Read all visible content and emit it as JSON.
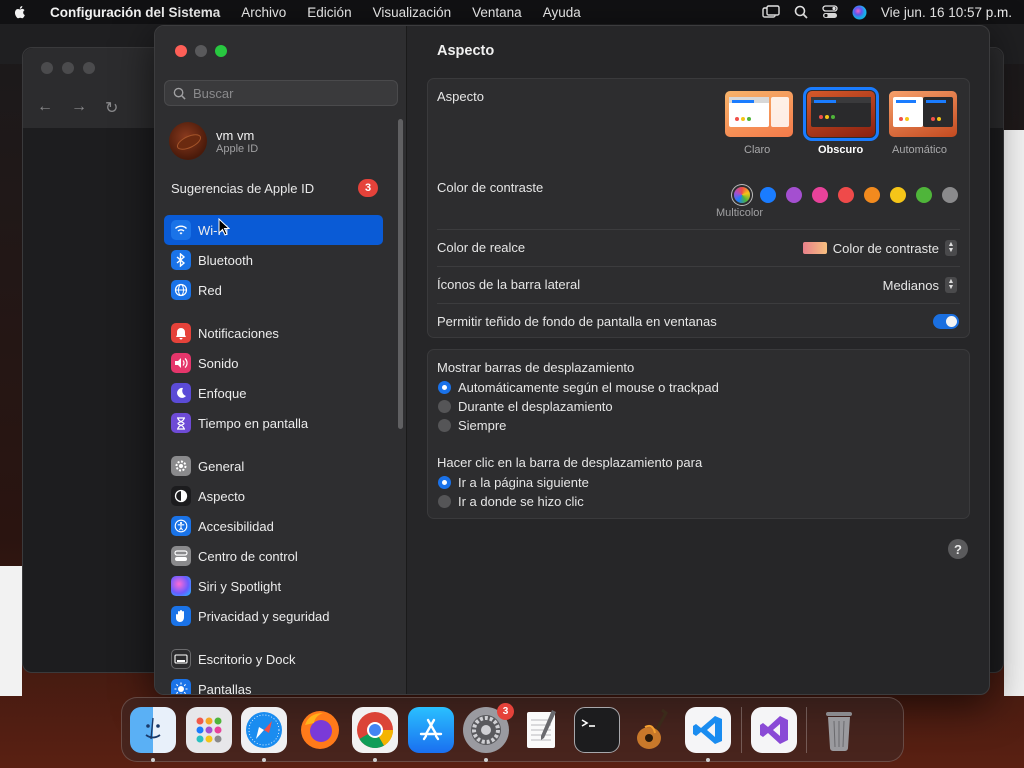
{
  "menubar": {
    "app_name": "Configuración del Sistema",
    "items": [
      "Archivo",
      "Edición",
      "Visualización",
      "Ventana",
      "Ayuda"
    ],
    "clock": "Vie jun. 16  10:57 p.m."
  },
  "sidebar": {
    "search_placeholder": "Buscar",
    "account_name": "vm vm",
    "account_sub": "Apple ID",
    "suggestions_label": "Sugerencias de Apple ID",
    "suggestions_count": "3",
    "items": [
      {
        "label": "Wi-Fi",
        "icon": "wifi-icon",
        "color": "#0a5bd6",
        "active": true
      },
      {
        "label": "Bluetooth",
        "icon": "bluetooth-icon",
        "color": "#1a73e8"
      },
      {
        "label": "Red",
        "icon": "globe-icon",
        "color": "#1a73e8"
      },
      {
        "label": "Notificaciones",
        "icon": "bell-icon",
        "color": "#e5423a"
      },
      {
        "label": "Sonido",
        "icon": "speaker-icon",
        "color": "#e5366b"
      },
      {
        "label": "Enfoque",
        "icon": "moon-icon",
        "color": "#5b4bd6"
      },
      {
        "label": "Tiempo en pantalla",
        "icon": "hourglass-icon",
        "color": "#6e4bd6"
      },
      {
        "label": "General",
        "icon": "gear-icon",
        "color": "#8a8a8c"
      },
      {
        "label": "Aspecto",
        "icon": "appearance-icon",
        "color": "#1c1c1e"
      },
      {
        "label": "Accesibilidad",
        "icon": "accessibility-icon",
        "color": "#1a73e8"
      },
      {
        "label": "Centro de control",
        "icon": "control-center-icon",
        "color": "#8a8a8c"
      },
      {
        "label": "Siri y Spotlight",
        "icon": "siri-icon",
        "color": "#8a3ad6"
      },
      {
        "label": "Privacidad y seguridad",
        "icon": "hand-icon",
        "color": "#1a73e8"
      },
      {
        "label": "Escritorio y Dock",
        "icon": "dock-icon",
        "color": "#2c2c2e"
      },
      {
        "label": "Pantallas",
        "icon": "display-icon",
        "color": "#1a73e8"
      }
    ]
  },
  "main": {
    "title": "Aspecto",
    "appearance": {
      "label": "Aspecto",
      "options": [
        "Claro",
        "Obscuro",
        "Automático"
      ],
      "selected": "Obscuro"
    },
    "contrast": {
      "label": "Color de contraste",
      "multicolor_label": "Multicolor",
      "colors": [
        "#1a7cff",
        "#a44fd0",
        "#e8429a",
        "#ef4a4a",
        "#f28a1e",
        "#f5c518",
        "#4fb53a",
        "#8a8a8c"
      ]
    },
    "highlight": {
      "label": "Color de realce",
      "value": "Color de contraste"
    },
    "sidebar_icons": {
      "label": "Íconos de la barra lateral",
      "value": "Medianos"
    },
    "tinting": {
      "label": "Permitir teñido de fondo de pantalla en ventanas",
      "enabled": true
    },
    "scrollbars": {
      "label": "Mostrar barras de desplazamiento",
      "options": [
        "Automáticamente según el mouse o trackpad",
        "Durante el desplazamiento",
        "Siempre"
      ],
      "selected": 0
    },
    "click_scroll": {
      "label": "Hacer clic en la barra de desplazamiento para",
      "options": [
        "Ir a la página siguiente",
        "Ir a donde se hizo clic"
      ],
      "selected": 0
    },
    "help_label": "?"
  },
  "dock": {
    "apps": [
      "finder",
      "launchpad",
      "safari",
      "firefox",
      "chrome",
      "app-store",
      "system-settings",
      "textedit",
      "terminal",
      "garageband",
      "vscode",
      "visual-studio",
      "trash"
    ],
    "settings_badge": "3"
  }
}
